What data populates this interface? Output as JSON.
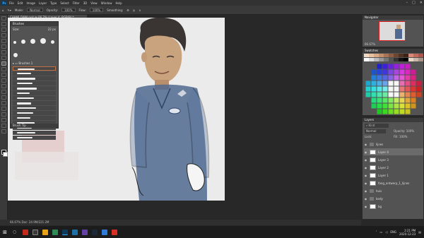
{
  "menubar": {
    "logo": "Ps",
    "items": [
      "File",
      "Edit",
      "Image",
      "Layer",
      "Type",
      "Select",
      "Filter",
      "3D",
      "View",
      "Window",
      "Help"
    ]
  },
  "window_controls": [
    "–",
    "□",
    "✕"
  ],
  "options_bar": {
    "mode_label": "Mode:",
    "mode_value": "Normal",
    "opacity_label": "Opacity:",
    "opacity_value": "100%",
    "flow_label": "Flow:",
    "flow_value": "100%",
    "smoothing_label": "Smoothing:"
  },
  "document_tab": {
    "title": "CHAMI_DANI.psd @ 66.7% (Layer 4, RGB/8) *"
  },
  "brushes_panel": {
    "title": "Brushes",
    "size_label": "Size:",
    "size_value": "22 px",
    "group_name": "Brushes 1",
    "footer": "Brush Tip"
  },
  "navigator_panel": {
    "title": "Navigator",
    "zoom": "66.67%"
  },
  "swatches_panel": {
    "title": "Swatches"
  },
  "layers_panel": {
    "title": "Layers",
    "search_placeholder": "Kind",
    "blend_mode": "Normal",
    "opacity_label": "Opacity:",
    "opacity_value": "100%",
    "lock_label": "Lock:",
    "fill_label": "Fill:",
    "fill_value": "100%",
    "rows": [
      {
        "name": "lijnes",
        "kind": "folder",
        "selected": false
      },
      {
        "name": "Layer 4",
        "kind": "layer",
        "selected": true
      },
      {
        "name": "Layer 3",
        "kind": "layer",
        "selected": false
      },
      {
        "name": "Layer 2",
        "kind": "layer",
        "selected": false
      },
      {
        "name": "Layer 1",
        "kind": "layer",
        "selected": false
      },
      {
        "name": "fang_ontwerp_1_lijnes",
        "kind": "layer",
        "selected": false
      },
      {
        "name": "huis",
        "kind": "folder",
        "selected": false
      },
      {
        "name": "body",
        "kind": "folder",
        "selected": false
      },
      {
        "name": "bg",
        "kind": "layer",
        "selected": false
      }
    ]
  },
  "status_bar": {
    "text": "66.67%     Doc: 24.9M/221.2M"
  },
  "taskbar": {
    "lang": "ENG",
    "time": "2:21 PM",
    "date": "2020-12-23"
  },
  "colors": {
    "accent": "#31a8ff",
    "uniform_blue": "#4f6a91",
    "skin": "#c9a27e",
    "hair": "#3a3532"
  }
}
